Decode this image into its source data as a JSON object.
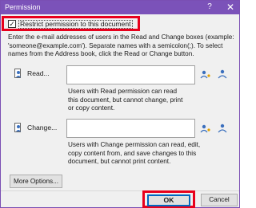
{
  "window": {
    "title": "Permission",
    "help_glyph": "?",
    "close_glyph": "✕",
    "accent_color": "#7b52b9"
  },
  "restrict": {
    "checked": true,
    "label": "Restrict permission to this document"
  },
  "instructions": "Enter the e-mail addresses of users in the Read and Change boxes (example: 'someone@example.com'). Separate names with a semicolon(;). To select names from the Address book, click the Read or Change button.",
  "read": {
    "button_label": "Read...",
    "input_value": "",
    "description": "Users with Read permission can read this document, but cannot change, print or copy content."
  },
  "change": {
    "button_label": "Change...",
    "input_value": "",
    "description": "Users with Change permission can read, edit, copy content from, and save changes to this document, but cannot print content."
  },
  "buttons": {
    "more_options": "More Options...",
    "ok": "OK",
    "cancel": "Cancel"
  },
  "highlight_color": "#e8001c"
}
